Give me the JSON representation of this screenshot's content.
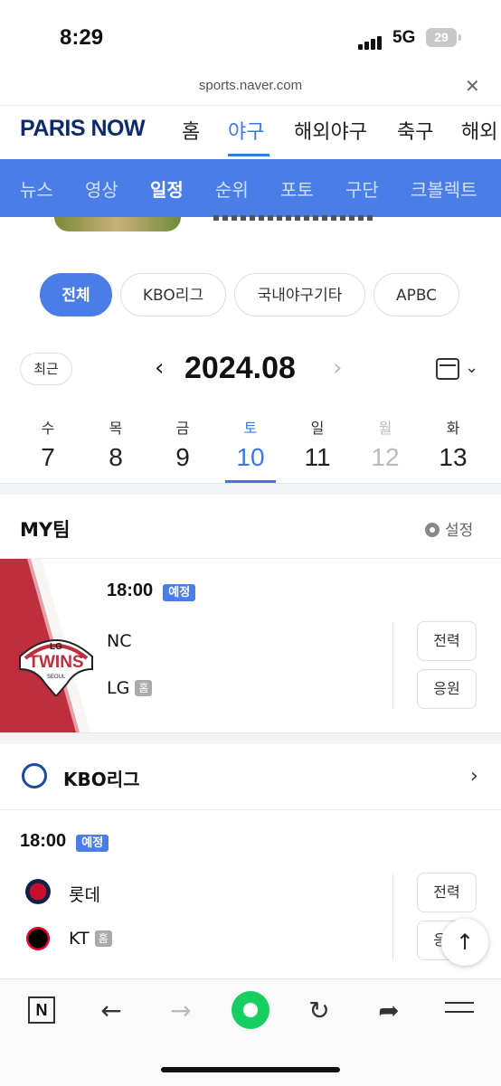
{
  "status": {
    "time": "8:29",
    "network": "5G",
    "battery": "29"
  },
  "browser": {
    "url": "sports.naver.com",
    "close_icon": "close-icon"
  },
  "topnav": {
    "logo": "PARIS NOW",
    "items": [
      "홈",
      "야구",
      "해외야구",
      "축구",
      "해외"
    ],
    "active": "야구"
  },
  "subnav": {
    "items": [
      "뉴스",
      "영상",
      "일정",
      "순위",
      "포토",
      "구단",
      "크볼렉트"
    ],
    "active": "일정"
  },
  "chips": [
    "전체",
    "KBO리그",
    "국내야구기타",
    "APBC"
  ],
  "calendar": {
    "recent_label": "최근",
    "month": "2024.08",
    "days": [
      {
        "weekday": "수",
        "date": "7"
      },
      {
        "weekday": "목",
        "date": "8"
      },
      {
        "weekday": "금",
        "date": "9"
      },
      {
        "weekday": "토",
        "date": "10"
      },
      {
        "weekday": "일",
        "date": "11"
      },
      {
        "weekday": "월",
        "date": "12"
      },
      {
        "weekday": "화",
        "date": "13"
      }
    ],
    "selected": "10"
  },
  "myteam": {
    "title": "MY팀",
    "settings_label": "설정",
    "game": {
      "time": "18:00",
      "status": "예정",
      "away": "NC",
      "home": "LG",
      "home_badge": "홈",
      "logo_top": "LG",
      "logo_name": "TWINS",
      "logo_sub": "SEOUL",
      "btn1": "전력",
      "btn2": "응원"
    }
  },
  "kbo": {
    "title": "KBO리그",
    "game": {
      "time": "18:00",
      "status": "예정",
      "away": "롯데",
      "home": "KT",
      "home_badge": "홈",
      "btn1": "전력",
      "btn2": "응원"
    }
  },
  "colors": {
    "accent": "#4a7ee6",
    "navy": "#0d2a6b",
    "twins_red": "#bf2e3e",
    "naver_green": "#19ce60"
  }
}
